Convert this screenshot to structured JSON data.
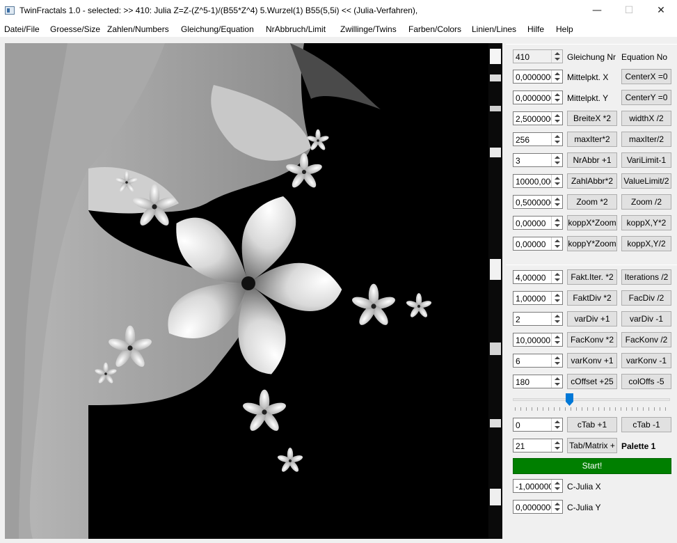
{
  "window": {
    "title": "TwinFractals 1.0 - selected: >> 410: Julia Z=Z-(Z^5-1)/(B55*Z^4) 5.Wurzel(1) B55(5,5i) << (Julia-Verfahren),",
    "minimize": "—",
    "maximize": "☐",
    "close": "✕"
  },
  "menu": [
    "Datei/File",
    "Groesse/Size",
    "Zahlen/Numbers",
    "Gleichung/Equation",
    "NrAbbruch/Limit",
    "Zwillinge/Twins",
    "Farben/Colors",
    "Linien/Lines",
    "Hilfe",
    "Help"
  ],
  "equation": {
    "value": "410",
    "label_de": "Gleichung Nr",
    "label_en": "Equation No"
  },
  "rows_top": [
    {
      "value": "0,0000000",
      "label": "Mittelpkt. X",
      "button": "CenterX =0"
    },
    {
      "value": "0,0000000",
      "label": "Mittelpkt. Y",
      "button": "CenterY =0"
    },
    {
      "value": "2,5000000",
      "button1": "BreiteX *2",
      "button2": "widthX /2"
    },
    {
      "value": "256",
      "button1": "maxIter*2",
      "button2": "maxIter/2"
    },
    {
      "value": "3",
      "button1": "NrAbbr +1",
      "button2": "VariLimit-1"
    },
    {
      "value": "10000,000",
      "button1": "ZahlAbbr*2",
      "button2": "ValueLimit/2"
    },
    {
      "value": "0,5000000",
      "button1": "Zoom *2",
      "button2": "Zoom /2"
    },
    {
      "value": "0,00000",
      "button1": "koppX*Zoom",
      "button2": "koppX,Y*2"
    },
    {
      "value": "0,00000",
      "button1": "koppY*Zoom",
      "button2": "koppX,Y/2"
    }
  ],
  "rows_mid": [
    {
      "value": "4,00000",
      "button1": "Fakt.Iter. *2",
      "button2": "Iterations /2"
    },
    {
      "value": "1,00000",
      "button1": "FaktDiv *2",
      "button2": "FacDiv /2"
    },
    {
      "value": "2",
      "button1": "varDiv +1",
      "button2": "varDiv -1"
    },
    {
      "value": "10,00000",
      "button1": "FacKonv *2",
      "button2": "FacKonv /2"
    },
    {
      "value": "6",
      "button1": "varKonv +1",
      "button2": "varKonv -1"
    },
    {
      "value": "180",
      "button1": "cOffset +25",
      "button2": "colOffs -5"
    }
  ],
  "slider": {
    "value": 0.36
  },
  "ctab": {
    "value": "0",
    "button1": "cTab +1",
    "button2": "cTab -1"
  },
  "tabmatrix": {
    "value": "21",
    "button": "Tab/Matrix +",
    "label": "Palette 1"
  },
  "start_label": "Start!",
  "julia_x": {
    "value": "-1,0000000",
    "label": "C-Julia X"
  },
  "julia_y": {
    "value": "0,0000000",
    "label": "C-Julia Y"
  },
  "colors": {
    "start": "#007f00",
    "slider_handle": "#0078d7",
    "canvas_bg": "#000000"
  }
}
